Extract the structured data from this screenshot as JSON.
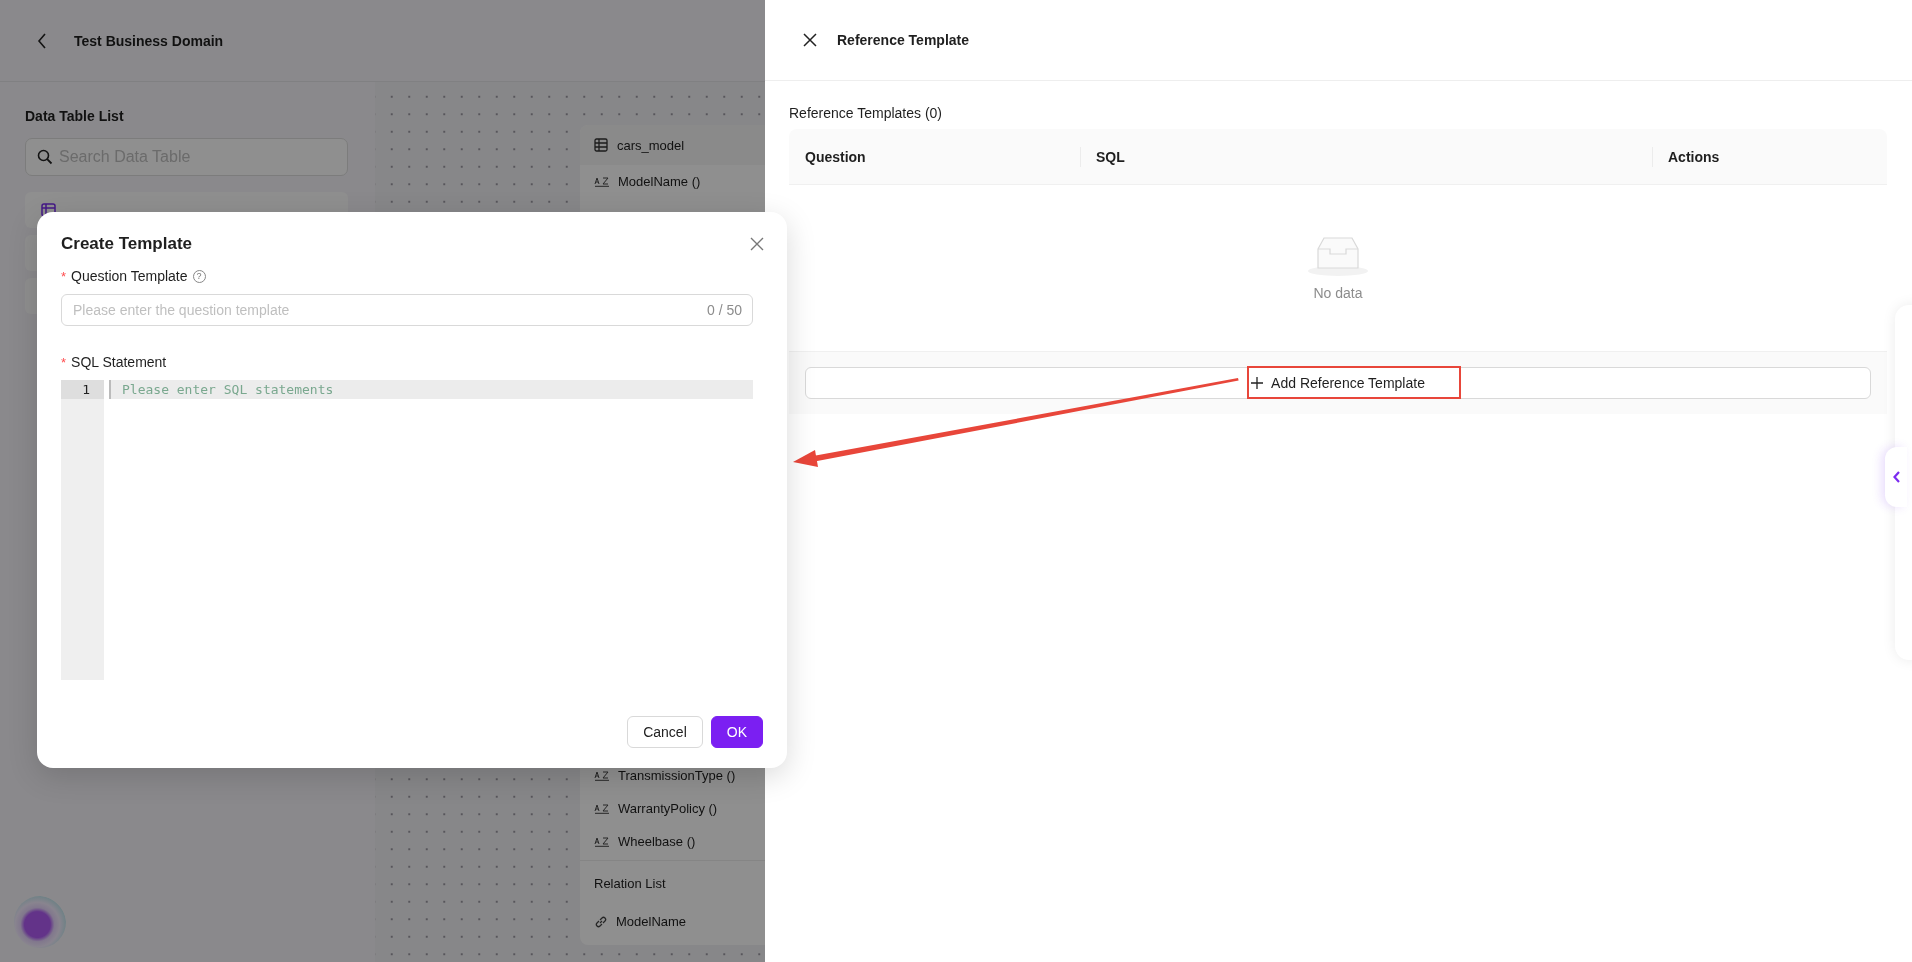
{
  "page": {
    "title": "Test Business Domain"
  },
  "sidebar": {
    "title": "Data Table List",
    "search": {
      "placeholder": "Search Data Table"
    }
  },
  "canvas": {
    "node": {
      "title": "cars_model",
      "fields_top": [
        "ModelName ()"
      ],
      "fields_bottom": [
        "TransmissionType ()",
        "WarrantyPolicy ()",
        "Wheelbase ()"
      ],
      "relations_title": "Relation List",
      "relations": [
        "ModelName"
      ]
    }
  },
  "drawer": {
    "title": "Reference Template",
    "section_title": "Reference Templates (0)",
    "columns": [
      "Question",
      "SQL",
      "Actions"
    ],
    "empty_text": "No data",
    "add_button": "Add Reference Template"
  },
  "modal": {
    "title": "Create Template",
    "fields": [
      {
        "kind": "text",
        "required_mark": "*",
        "label": "Question Template",
        "help_icon": "?",
        "placeholder": "Please enter the question template",
        "counter": "0 / 50"
      },
      {
        "kind": "code",
        "required_mark": "*",
        "label": "SQL Statement",
        "line_number": "1",
        "placeholder": "Please enter SQL statements"
      }
    ],
    "buttons": [
      {
        "label": "Cancel",
        "kind": "default"
      },
      {
        "label": "OK",
        "kind": "primary"
      }
    ]
  }
}
